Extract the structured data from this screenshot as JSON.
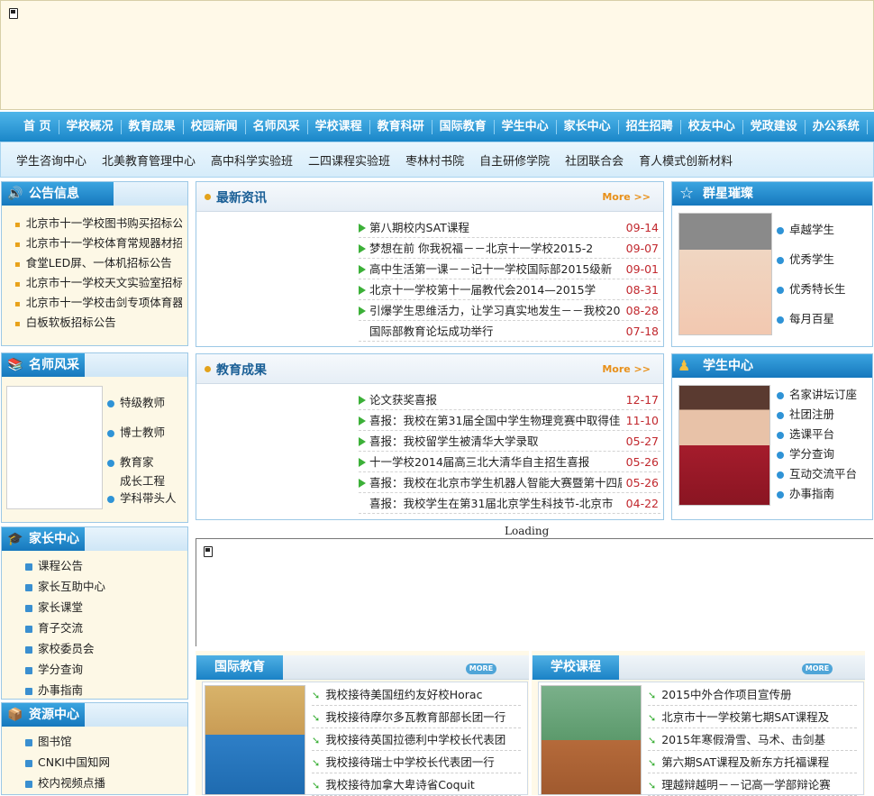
{
  "mainnav": [
    "首 页",
    "学校概况",
    "教育成果",
    "校园新闻",
    "名师风采",
    "学校课程",
    "教育科研",
    "国际教育",
    "学生中心",
    "家长中心",
    "招生招聘",
    "校友中心",
    "党政建设",
    "办公系统"
  ],
  "subnav": [
    "学生咨询中心",
    "北美教育管理中心",
    "高中科学实验班",
    "二四课程实验班",
    "枣林村书院",
    "自主研修学院",
    "社团联合会",
    "育人模式创新材料"
  ],
  "notice": {
    "title": "公告信息",
    "items": [
      "北京市十一学校图书购买招标公告",
      "北京市十一学校体育常规器材招标",
      "食堂LED屏、一体机招标公告",
      "北京市十一学校天文实验室招标",
      "北京市十一学校击剑专项体育器材",
      "白板软板招标公告"
    ]
  },
  "teachers": {
    "title": "名师风采",
    "items": [
      "特级教师",
      "博士教师",
      "教育家",
      "成长工程",
      "学科带头人"
    ]
  },
  "parents": {
    "title": "家长中心",
    "items": [
      "课程公告",
      "家长互助中心",
      "家长课堂",
      "育子交流",
      "家校委员会",
      "学分查询",
      "办事指南"
    ]
  },
  "resources": {
    "title": "资源中心",
    "items": [
      "图书馆",
      "CNKI中国知网",
      "校内视频点播"
    ]
  },
  "latest": {
    "title": "最新资讯",
    "more": "More >>",
    "items": [
      {
        "t": "第八期校内SAT课程",
        "d": "09-14"
      },
      {
        "t": "梦想在前 你我祝福－－北京十一学校2015-2",
        "d": "09-07"
      },
      {
        "t": "高中生活第一课－－记十一学校国际部2015级新",
        "d": "09-01"
      },
      {
        "t": "北京十一学校第十一届教代会2014—2015学",
        "d": "08-31"
      },
      {
        "t": "引爆学生思维活力，让学习真实地发生－－我校20",
        "d": "08-28"
      },
      {
        "t": "国际部教育论坛成功举行",
        "d": "07-18"
      }
    ]
  },
  "results": {
    "title": "教育成果",
    "more": "More >>",
    "items": [
      {
        "t": "论文获奖喜报",
        "d": "12-17"
      },
      {
        "t": "喜报：我校在第31届全国中学生物理竞赛中取得佳",
        "d": "11-10"
      },
      {
        "t": "喜报：我校留学生被清华大学录取",
        "d": "05-27"
      },
      {
        "t": "十一学校2014届高三北大清华自主招生喜报",
        "d": "05-26"
      },
      {
        "t": "喜报：我校在北京市学生机器人智能大赛暨第十四届",
        "d": "05-26"
      },
      {
        "t": "喜报：我校学生在第31届北京学生科技节-北京市",
        "d": "04-22"
      }
    ]
  },
  "stars": {
    "title": "群星璀璨",
    "items": [
      "卓越学生",
      "优秀学生",
      "优秀特长生",
      "每月百星"
    ]
  },
  "student_center": {
    "title": "学生中心",
    "items": [
      "名家讲坛订座",
      "社团注册",
      "选课平台",
      "学分查询",
      "互动交流平台",
      "办事指南"
    ]
  },
  "loading": "Loading",
  "intl": {
    "title": "国际教育",
    "more": "MORE",
    "items": [
      "我校接待美国纽约友好校Horac",
      "我校接待摩尔多瓦教育部部长团一行",
      "我校接待英国拉德利中学校长代表团",
      "我校接待瑞士中学校长代表团一行",
      "我校接待加拿大卑诗省Coquit"
    ]
  },
  "courses": {
    "title": "学校课程",
    "more": "MORE",
    "items": [
      "2015中外合作项目宣传册",
      "北京市十一学校第七期SAT课程及",
      "2015年寒假滑雪、马术、击剑基",
      "第六期SAT课程及新东方托福课程",
      "理越辩越明－－记高一学部辩论赛"
    ]
  }
}
